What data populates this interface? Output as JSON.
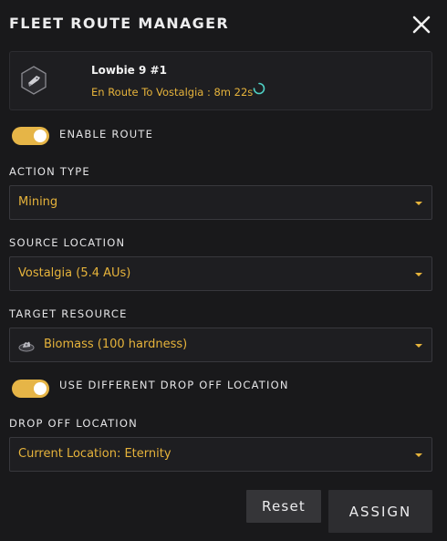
{
  "header": {
    "title": "FLEET ROUTE MANAGER",
    "close_icon": "close-icon"
  },
  "ship": {
    "icon": "ship-icon",
    "name": "Lowbie 9 #1",
    "status": "En Route To Vostalgia : 8m 22s",
    "status_icon": "loading-spinner-icon"
  },
  "enable_route": {
    "label": "ENABLE ROUTE",
    "on": true
  },
  "action_type": {
    "label": "ACTION TYPE",
    "value": "Mining"
  },
  "source_location": {
    "label": "SOURCE LOCATION",
    "value": "Vostalgia (5.4 AUs)"
  },
  "target_resource": {
    "label": "TARGET RESOURCE",
    "value": "Biomass (100 hardness)",
    "icon": "biomass-icon"
  },
  "different_drop_off": {
    "label": "USE DIFFERENT DROP OFF LOCATION",
    "on": true
  },
  "drop_off_location": {
    "label": "DROP OFF LOCATION",
    "value": "Current Location: Eternity"
  },
  "actions": {
    "reset_label": "Reset",
    "assign_label": "ASSIGN"
  },
  "colors": {
    "accent": "#e6b33b",
    "toggle_on": "#e6b547",
    "background": "#19191b",
    "panel": "#1e1e21",
    "spinner": "#4fd1c5"
  }
}
